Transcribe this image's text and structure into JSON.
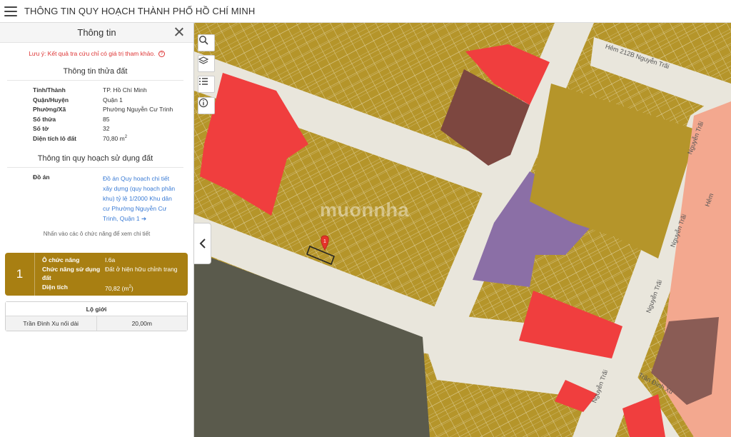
{
  "app": {
    "title": "THÔNG TIN QUY HOẠCH THÀNH PHỐ HỒ CHÍ MINH"
  },
  "panel": {
    "title": "Thông tin",
    "note": "Lưu ý: Kết quả tra cứu chỉ có giá trị tham khảo.",
    "parcel_section_title": "Thông tin thửa đất",
    "parcel": {
      "province_label": "Tỉnh/Thành",
      "province_value": "TP. Hồ Chí Minh",
      "district_label": "Quận/Huyện",
      "district_value": "Quận 1",
      "ward_label": "Phường/Xã",
      "ward_value": "Phường Nguyễn Cư Trinh",
      "sheet_no_label": "Số thửa",
      "sheet_no_value": "85",
      "map_sheet_label": "Số tờ",
      "map_sheet_value": "32",
      "area_label": "Diện tích lô đất",
      "area_value": "70,80 m",
      "area_unit_sup": "2"
    },
    "landuse_section_title": "Thông tin quy hoạch sử dụng đất",
    "project_label": "Đồ án",
    "project_link": "Đồ án Quy hoạch chi tiết xây dựng (quy hoạch phân khu) tỷ lệ 1/2000 Khu dân cư Phường Nguyễn Cư Trinh, Quận 1",
    "hint": "Nhấn vào các ô chức năng để xem chi tiết",
    "function_card": {
      "number": "1",
      "zone_label": "Ô chức năng",
      "zone_value": "I.6a",
      "function_label": "Chức năng sử dụng đất",
      "function_value": "Đất ở hiện hữu chỉnh trang",
      "area_label": "Diện tích",
      "area_value": "70,82 (m",
      "area_sup": "2",
      "area_close": ")"
    },
    "setback": {
      "header": "Lộ giới",
      "rows": [
        {
          "street": "Trần Đình Xu nối dài",
          "width": "20,00m"
        }
      ]
    }
  },
  "map": {
    "watermark": "muonnha",
    "marker_label": "1",
    "streets": {
      "hem": "Hẻm 212B Nguyễn Trãi",
      "nguyen_trai_1": "Nguyễn Trãi",
      "nguyen_trai_2": "Nguyễn Trãi",
      "nguyen_trai_3": "Nguyễn Trãi",
      "nguyen_trai_4": "Nguyễn Trãi",
      "tran_dinh_xu": "Trần Đình Xu",
      "hem_right": "Hẻm"
    },
    "colors": {
      "residential": "#b5952a",
      "road": "#e9e6dc",
      "commercial": "#f03e3e",
      "public": "#7d4740",
      "education": "#8b6fa6",
      "green": "#5a5a4c",
      "mixed": "#f3a88f"
    }
  }
}
